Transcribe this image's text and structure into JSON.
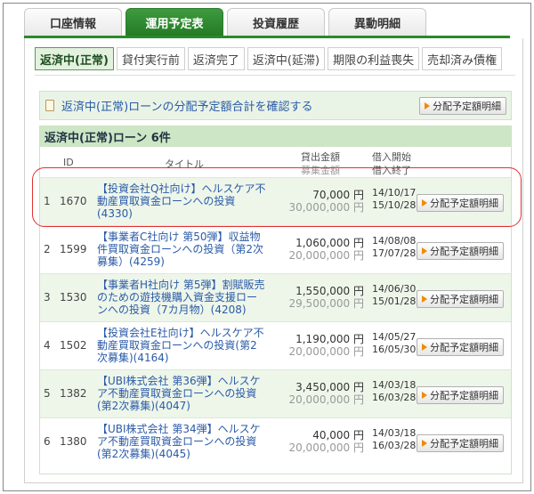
{
  "tabs": [
    "口座情報",
    "運用予定表",
    "投資履歴",
    "異動明細"
  ],
  "active_tab": 1,
  "subtabs": [
    "返済中(正常)",
    "貸付実行前",
    "返済完了",
    "返済中(延滞)",
    "期限の利益喪失",
    "売却済み債権"
  ],
  "active_subtab": 0,
  "confirm": {
    "text": "返済中(正常)ローンの分配予定額合計を確認する",
    "button": "分配予定額明細"
  },
  "section": {
    "title": "返済中(正常)ローン 6件",
    "headers": {
      "id": "ID",
      "title": "タイトル",
      "amount1": "貸出金額",
      "amount2": "募集金額",
      "date1": "借入開始",
      "date2": "借入終了"
    }
  },
  "button_label": "分配予定額明細",
  "rows": [
    {
      "no": "1",
      "id": "1670",
      "title": "【投資会社Q社向け】ヘルスケア不動産買取資金ローンへの投資(4330)",
      "amount1": "70,000 円",
      "amount2": "30,000,000 円",
      "start": "14/10/17",
      "end": "15/10/28"
    },
    {
      "no": "2",
      "id": "1599",
      "title": "【事業者C社向け 第50弾】収益物件買取資金ローンへの投資（第2次募集）(4259)",
      "amount1": "1,060,000 円",
      "amount2": "20,000,000 円",
      "start": "14/08/08",
      "end": "17/07/28"
    },
    {
      "no": "3",
      "id": "1530",
      "title": "【事業者H社向け 第5弾】割賦販売のための遊技機購入資金支援ローンへの投資（7カ月物）(4208)",
      "amount1": "1,550,000 円",
      "amount2": "29,500,000 円",
      "start": "14/06/30",
      "end": "15/01/28"
    },
    {
      "no": "4",
      "id": "1502",
      "title": "【投資会社E社向け】ヘルスケア不動産買取資金ローンへの投資(第2次募集)(4164)",
      "amount1": "1,190,000 円",
      "amount2": "20,000,000 円",
      "start": "14/05/27",
      "end": "16/05/30"
    },
    {
      "no": "5",
      "id": "1382",
      "title": "【UBI株式会社 第36弾】ヘルスケア不動産買取資金ローンへの投資(第2次募集)(4047)",
      "amount1": "3,450,000 円",
      "amount2": "20,000,000 円",
      "start": "14/03/18",
      "end": "16/03/28"
    },
    {
      "no": "6",
      "id": "1380",
      "title": "【UBI株式会社 第34弾】ヘルスケア不動産買取資金ローンへの投資(第2次募集)(4045)",
      "amount1": "40,000 円",
      "amount2": "20,000,000 円",
      "start": "14/03/18",
      "end": "16/03/28"
    }
  ],
  "colors": {
    "accent": "#2b8a2b",
    "link": "#2a5ba8",
    "highlight": "#e23030"
  }
}
